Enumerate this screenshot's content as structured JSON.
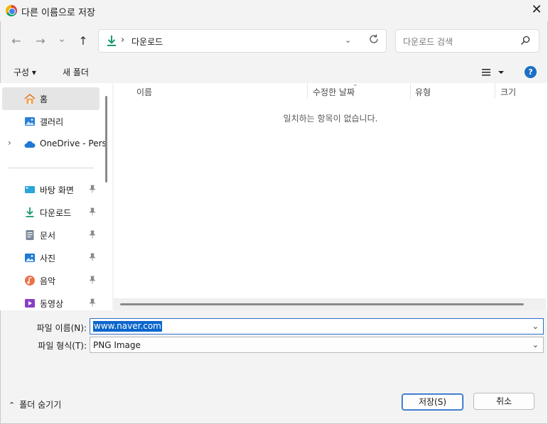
{
  "window": {
    "title": "다른 이름으로 저장"
  },
  "nav": {
    "back": "←",
    "forward": "→",
    "recent": "⌄",
    "up": "↑"
  },
  "address": {
    "separator": "›",
    "location": "다운로드"
  },
  "search": {
    "placeholder": "다운로드 검색"
  },
  "toolbar": {
    "organize": "구성 ▾",
    "new_folder": "새 폴더"
  },
  "sidebar": {
    "items": [
      {
        "label": "홈",
        "icon": "home-icon"
      },
      {
        "label": "갤러리",
        "icon": "gallery-icon"
      },
      {
        "label": "OneDrive - Pers",
        "icon": "onedrive-cloud-icon"
      },
      {
        "label": "바탕 화면",
        "icon": "desktop-icon"
      },
      {
        "label": "다운로드",
        "icon": "download-icon"
      },
      {
        "label": "문서",
        "icon": "document-icon"
      },
      {
        "label": "사진",
        "icon": "pictures-icon"
      },
      {
        "label": "음악",
        "icon": "music-icon"
      },
      {
        "label": "동영상",
        "icon": "video-icon"
      }
    ]
  },
  "file_list": {
    "columns": [
      "이름",
      "수정한 날짜",
      "유형",
      "크기"
    ],
    "empty_message": "일치하는 항목이 없습니다."
  },
  "form": {
    "file_name_label": "파일 이름(N):",
    "file_name_value": "www.naver.com",
    "file_type_label": "파일 형식(T):",
    "file_type_value": "PNG Image"
  },
  "footer": {
    "hide_folders": "폴더 숨기기",
    "save": "저장(S)",
    "cancel": "취소"
  },
  "colors": {
    "accent": "#0a66cc",
    "download_green": "#1a9b6c",
    "help_blue": "#1b6fc6"
  }
}
